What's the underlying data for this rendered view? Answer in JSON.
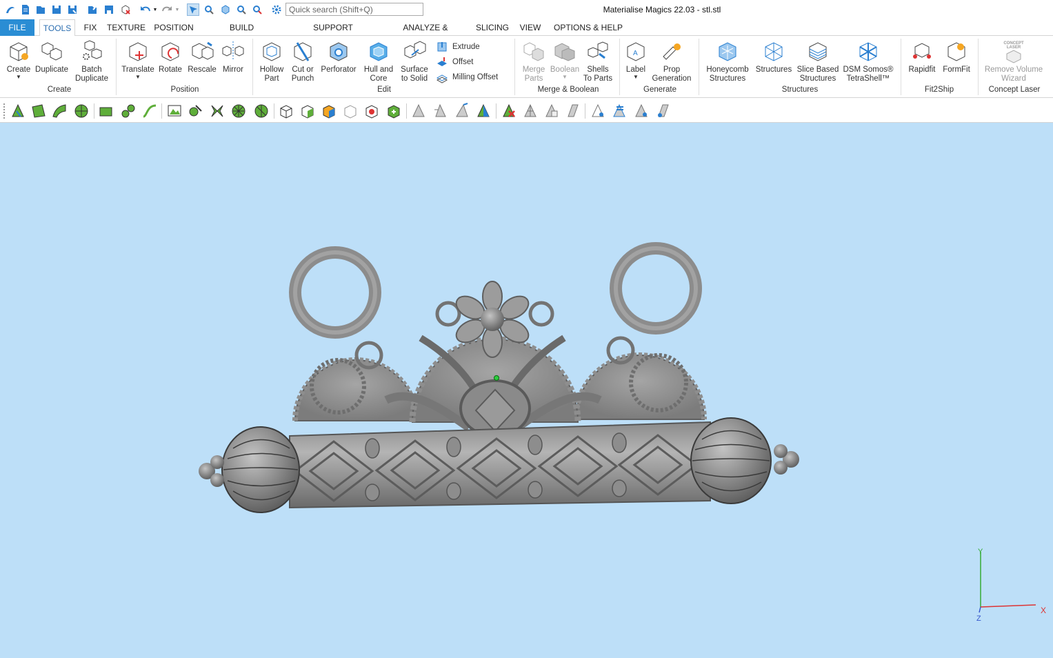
{
  "window": {
    "title": "Materialise Magics 22.03 - stl.stl"
  },
  "quick_access": {
    "search_placeholder": "Quick search (Shift+Q)",
    "icons": [
      "app-logo-icon",
      "new-project-icon",
      "open-icon",
      "save-icon",
      "save-as-icon",
      "import-part-icon",
      "save-part-icon",
      "unload-part-icon",
      "undo-icon",
      "redo-icon",
      "select-mode-icon",
      "zoom-select-icon",
      "view-part-icon",
      "zoom-icon",
      "zoom-reset-icon",
      "settings-icon"
    ]
  },
  "menu": {
    "tabs": [
      {
        "label": "FILE"
      },
      {
        "label": "TOOLS"
      },
      {
        "label": "FIX"
      },
      {
        "label": "TEXTURE"
      },
      {
        "label": "POSITION"
      },
      {
        "label": "BUILD PREPARATION"
      },
      {
        "label": "SUPPORT GENERATION"
      },
      {
        "label": "ANALYZE & REPORT"
      },
      {
        "label": "SLICING"
      },
      {
        "label": "VIEW"
      },
      {
        "label": "OPTIONS & HELP"
      }
    ],
    "active": "TOOLS"
  },
  "ribbon": {
    "create": {
      "group": "Create",
      "create": "Create",
      "duplicate": "Duplicate",
      "batch_duplicate_1": "Batch",
      "batch_duplicate_2": "Duplicate"
    },
    "position": {
      "group": "Position",
      "translate": "Translate",
      "rotate": "Rotate",
      "rescale": "Rescale",
      "mirror": "Mirror"
    },
    "edit": {
      "group": "Edit",
      "hollow_1": "Hollow",
      "hollow_2": "Part",
      "cut_1": "Cut or",
      "cut_2": "Punch",
      "perforator": "Perforator",
      "hull_1": "Hull and",
      "hull_2": "Core",
      "surface_1": "Surface",
      "surface_2": "to Solid",
      "extrude": "Extrude",
      "offset": "Offset",
      "milling_offset": "Milling Offset"
    },
    "merge": {
      "group": "Merge & Boolean",
      "merge_1": "Merge",
      "merge_2": "Parts",
      "boolean": "Boolean",
      "shells_1": "Shells",
      "shells_2": "To Parts"
    },
    "generate": {
      "group": "Generate",
      "label": "Label",
      "prop_1": "Prop",
      "prop_2": "Generation"
    },
    "structures": {
      "group": "Structures",
      "honeycomb_1": "Honeycomb",
      "honeycomb_2": "Structures",
      "structures": "Structures",
      "slice_1": "Slice Based",
      "slice_2": "Structures",
      "dsm_1": "DSM Somos®",
      "dsm_2": "TetraShell™"
    },
    "fit2ship": {
      "group": "Fit2Ship",
      "rapidfit": "Rapidfit",
      "formfit": "FormFit"
    },
    "concept": {
      "group": "Concept Laser",
      "remove_1": "Remove Volume",
      "remove_2": "Wizard",
      "logo_text": "CONCEPT LASER"
    }
  },
  "viewport": {
    "background": "#bddff8",
    "axis_labels": {
      "x": "X",
      "y": "Y",
      "z": "Z"
    }
  },
  "colors": {
    "accent": "#2a8dd4",
    "icon_green": "#5fae3a",
    "icon_blue": "#3b8fd6"
  }
}
